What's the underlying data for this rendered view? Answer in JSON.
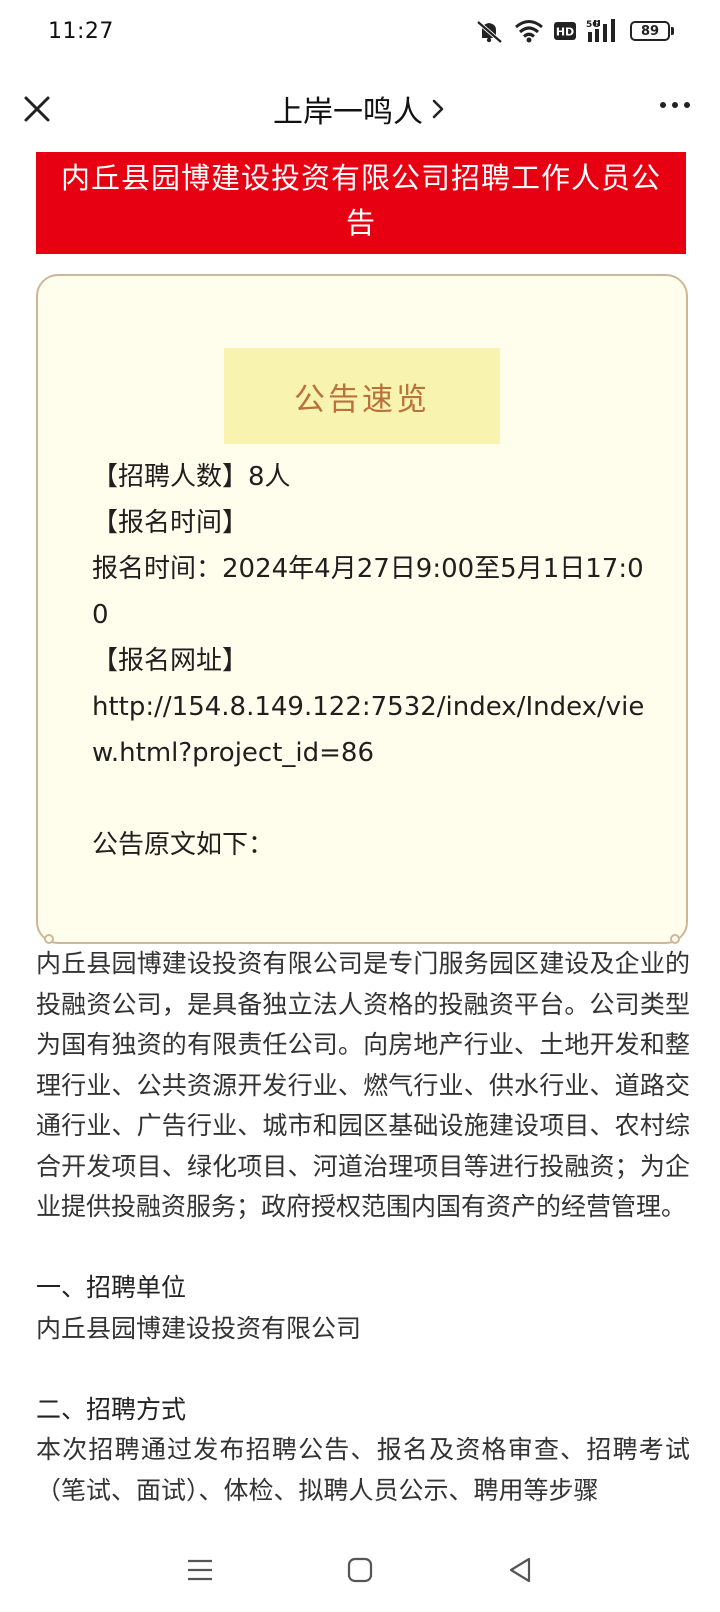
{
  "status_bar": {
    "time": "11:27",
    "battery": "89",
    "network": "5G",
    "hd": "HD",
    "icons": [
      "mute-icon",
      "wifi-icon",
      "hd-icon",
      "signal-icon",
      "battery-icon"
    ]
  },
  "nav": {
    "title": "上岸一鸣人",
    "chevron": "›",
    "icons": [
      "close-icon",
      "more-icon"
    ]
  },
  "banner": {
    "title": "内丘县园博建设投资有限公司招聘工作人员公告"
  },
  "card": {
    "title": "公告速览",
    "count_line": "【招聘人数】8人",
    "time_heading": "【报名时间】",
    "time_line": "报名时间：2024年4月27日9:00至5月1日17:00",
    "url_heading": "【报名网址】",
    "url": "http://154.8.149.122:7532/index/Index/view.html?project_id=86",
    "original_heading": "公告原文如下："
  },
  "article": {
    "intro": "内丘县园博建设投资有限公司是专门服务园区建设及企业的投融资公司，是具备独立法人资格的投融资平台。公司类型为国有独资的有限责任公司。向房地产行业、土地开发和整理行业、公共资源开发行业、燃气行业、供水行业、道路交通行业、广告行业、城市和园区基础设施建设项目、农村综合开发项目、绿化项目、河道治理项目等进行投融资；为企业提供投融资服务；政府授权范围内国有资产的经营管理。",
    "section1_heading": "一、招聘单位",
    "section1_text": "内丘县园博建设投资有限公司",
    "section2_heading": "二、招聘方式",
    "section2_text": "本次招聘通过发布招聘公告、报名及资格审查、招聘考试（笔试、面试）、体检、拟聘人员公示、聘用等步骤"
  },
  "bottom_nav": {
    "icons": [
      "menu-icon",
      "home-icon",
      "back-icon"
    ]
  }
}
